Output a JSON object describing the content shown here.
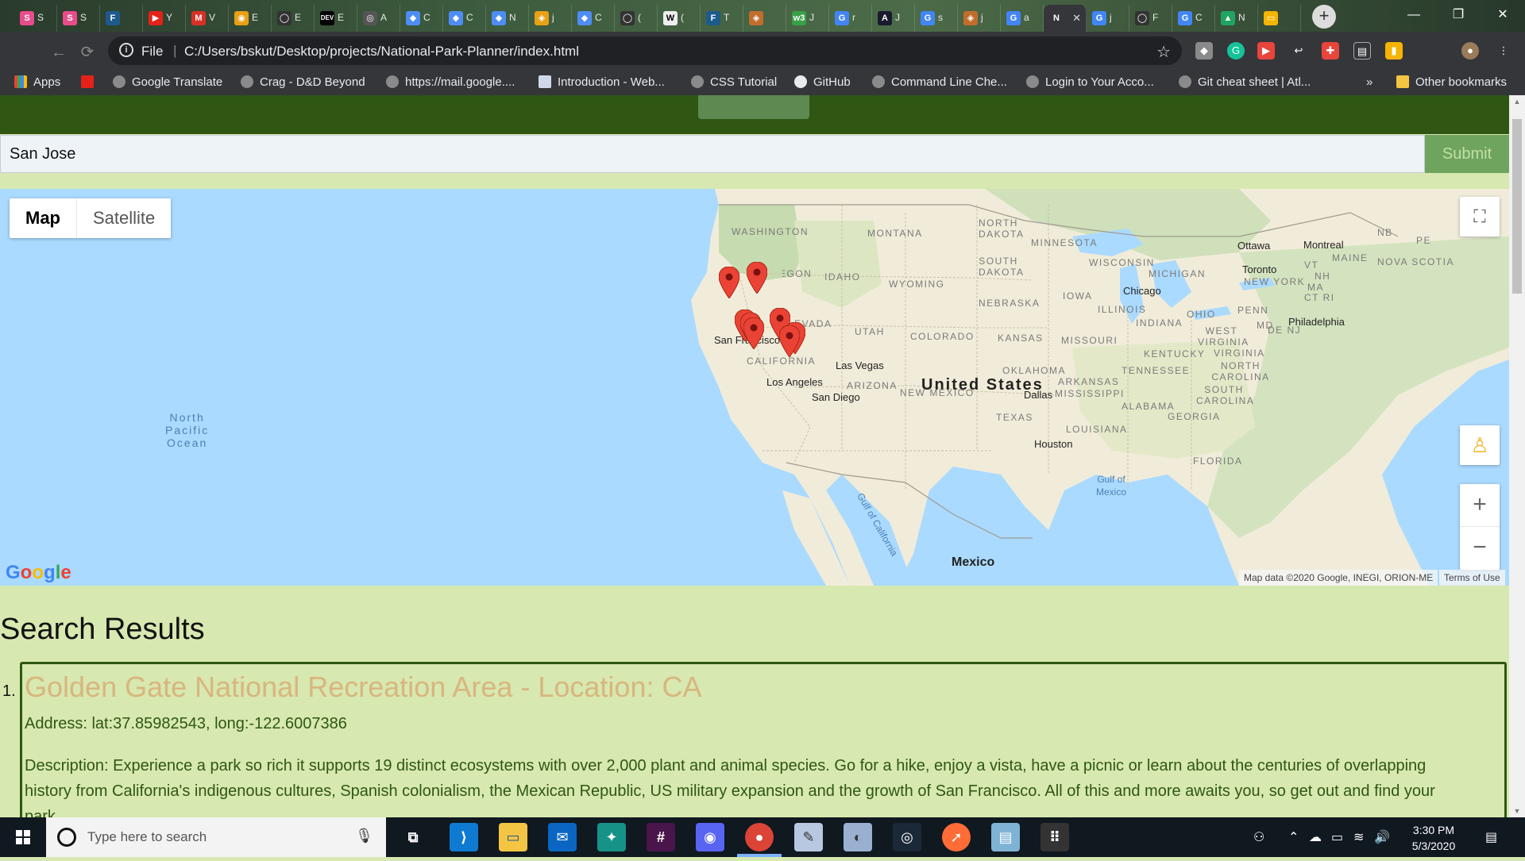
{
  "browser": {
    "tabs": [
      {
        "icon": "S",
        "label": "S",
        "color": "#e84c8b"
      },
      {
        "icon": "S",
        "label": "S",
        "color": "#e84c8b"
      },
      {
        "icon": "F",
        "label": "",
        "color": "#1d5a8c"
      },
      {
        "icon": "▶",
        "label": "Y",
        "color": "#e62117"
      },
      {
        "icon": "M",
        "label": "V",
        "color": "#d93025"
      },
      {
        "icon": "◉",
        "label": "E",
        "color": "#e8a015"
      },
      {
        "icon": "◯",
        "label": "E",
        "color": "#333333"
      },
      {
        "icon": "DEV",
        "label": "E",
        "color": "#000000"
      },
      {
        "icon": "◎",
        "label": "A",
        "color": "#555555"
      },
      {
        "icon": "◆",
        "label": "C",
        "color": "#4d8df5"
      },
      {
        "icon": "◆",
        "label": "C",
        "color": "#4d8df5"
      },
      {
        "icon": "◆",
        "label": "N",
        "color": "#4d8df5"
      },
      {
        "icon": "◈",
        "label": "j",
        "color": "#e8a015"
      },
      {
        "icon": "◆",
        "label": "C",
        "color": "#4d8df5"
      },
      {
        "icon": "◯",
        "label": "(",
        "color": "#333333"
      },
      {
        "icon": "W",
        "label": "(",
        "color": "#eeeeee"
      },
      {
        "icon": "F",
        "label": "T",
        "color": "#1d5a8c"
      },
      {
        "icon": "◈",
        "label": "",
        "color": "#c26d2c"
      },
      {
        "icon": "w3",
        "label": "J",
        "color": "#38a047"
      },
      {
        "icon": "G",
        "label": "r",
        "color": "#4285f4"
      },
      {
        "icon": "A",
        "label": "J",
        "color": "#1a1a2e"
      },
      {
        "icon": "G",
        "label": "s",
        "color": "#4285f4"
      },
      {
        "icon": "◈",
        "label": "j",
        "color": "#c26d2c"
      },
      {
        "icon": "G",
        "label": "a",
        "color": "#4285f4"
      },
      {
        "icon": "N",
        "label": "",
        "color": "#35363a",
        "active": true
      },
      {
        "icon": "G",
        "label": "j",
        "color": "#4285f4"
      },
      {
        "icon": "◯",
        "label": "F",
        "color": "#333333"
      },
      {
        "icon": "G",
        "label": "C",
        "color": "#4285f4"
      },
      {
        "icon": "▲",
        "label": "N",
        "color": "#1fa463"
      },
      {
        "icon": "▭",
        "label": "",
        "color": "#f4b400"
      }
    ],
    "new_tab": "+",
    "window_controls": {
      "minimize": "—",
      "restore": "❐",
      "close": "✕"
    },
    "file_label": "File",
    "url": "C:/Users/bskut/Desktop/projects/National-Park-Planner/index.html",
    "bookmarks": [
      {
        "label": "Apps",
        "icon": "apps-grid-icon"
      },
      {
        "label": "",
        "icon": "youtube-icon"
      },
      {
        "label": "Google Translate",
        "icon": "globe-icon"
      },
      {
        "label": "Crag - D&D Beyond",
        "icon": "globe-icon"
      },
      {
        "label": "https://mail.google....",
        "icon": "globe-icon"
      },
      {
        "label": "Introduction - Web...",
        "icon": "page-icon"
      },
      {
        "label": "CSS Tutorial",
        "icon": "globe-icon"
      },
      {
        "label": "GitHub",
        "icon": "github-icon"
      },
      {
        "label": "Command Line Che...",
        "icon": "globe-icon"
      },
      {
        "label": "Login to Your Acco...",
        "icon": "globe-icon"
      },
      {
        "label": "Git cheat sheet | Atl...",
        "icon": "globe-icon"
      }
    ],
    "bookmarks_overflow": "»",
    "other_bookmarks": "Other bookmarks"
  },
  "search": {
    "value": "San Jose",
    "submit_label": "Submit"
  },
  "map": {
    "type_options": [
      "Map",
      "Satellite"
    ],
    "selected_type": "Map",
    "zoom_in": "+",
    "zoom_out": "−",
    "logo": "Google",
    "attribution": "Map data ©2020 Google, INEGI, ORION-ME",
    "terms": "Terms of Use",
    "labels": {
      "countries": [
        "United States",
        "Mexico"
      ],
      "oceans": [
        "North Pacific Ocean",
        "Gulf of Mexico",
        "Gulf of California"
      ],
      "states": [
        "WASHINGTON",
        "MONTANA",
        "NORTH DAKOTA",
        "MINNESOTA",
        "OREGON",
        "IDAHO",
        "WYOMING",
        "SOUTH DAKOTA",
        "WISCONSIN",
        "MICHIGAN",
        "NEBRASKA",
        "IOWA",
        "ILLINOIS",
        "OHIO",
        "PENN",
        "NEVADA",
        "UTAH",
        "COLORADO",
        "KANSAS",
        "MISSOURI",
        "INDIANA",
        "WEST VIRGINIA",
        "VIRGINIA",
        "KENTUCKY",
        "CALIFORNIA",
        "ARIZONA",
        "NEW MEXICO",
        "OKLAHOMA",
        "ARKANSAS",
        "TENNESSEE",
        "NORTH CAROLINA",
        "SOUTH CAROLINA",
        "MISSISSIPPI",
        "ALABAMA",
        "GEORGIA",
        "TEXAS",
        "LOUISIANA",
        "FLORIDA",
        "MAINE",
        "NOVA SCOTIA",
        "NB",
        "PE",
        "VT",
        "NH",
        "MA",
        "CT RI",
        "MD",
        "DE NJ",
        "NEW YORK"
      ],
      "cities": [
        "Ottawa",
        "Montreal",
        "Toronto",
        "Chicago",
        "Philadelphia",
        "San Francisco",
        "Las Vegas",
        "Los Angeles",
        "San Diego",
        "Dallas",
        "Houston"
      ]
    },
    "marker_count": 8
  },
  "results": {
    "heading": "Search Results",
    "items": [
      {
        "number": "1.",
        "title": "Golden Gate National Recreation Area - Location: CA",
        "address": "Address: lat:37.85982543, long:-122.6007386",
        "description": "Description: Experience a park so rich it supports 19 distinct ecosystems with over 2,000 plant and animal species. Go for a hike, enjoy a vista, have a picnic or learn about the centuries of overlapping history from California's indigenous cultures, Spanish colonialism, the Mexican Republic, US military expansion and the growth of San Francisco. All of this and more awaits you, so get out and find your park."
      }
    ]
  },
  "taskbar": {
    "search_placeholder": "Type here to search",
    "time": "3:30 PM",
    "date": "5/3/2020",
    "apps": [
      "task-view",
      "vscode",
      "file-explorer",
      "mail",
      "git-kraken",
      "slack",
      "discord",
      "chrome",
      "paint",
      "paint-3d",
      "steam",
      "postman",
      "notepad",
      "tray-app"
    ]
  }
}
